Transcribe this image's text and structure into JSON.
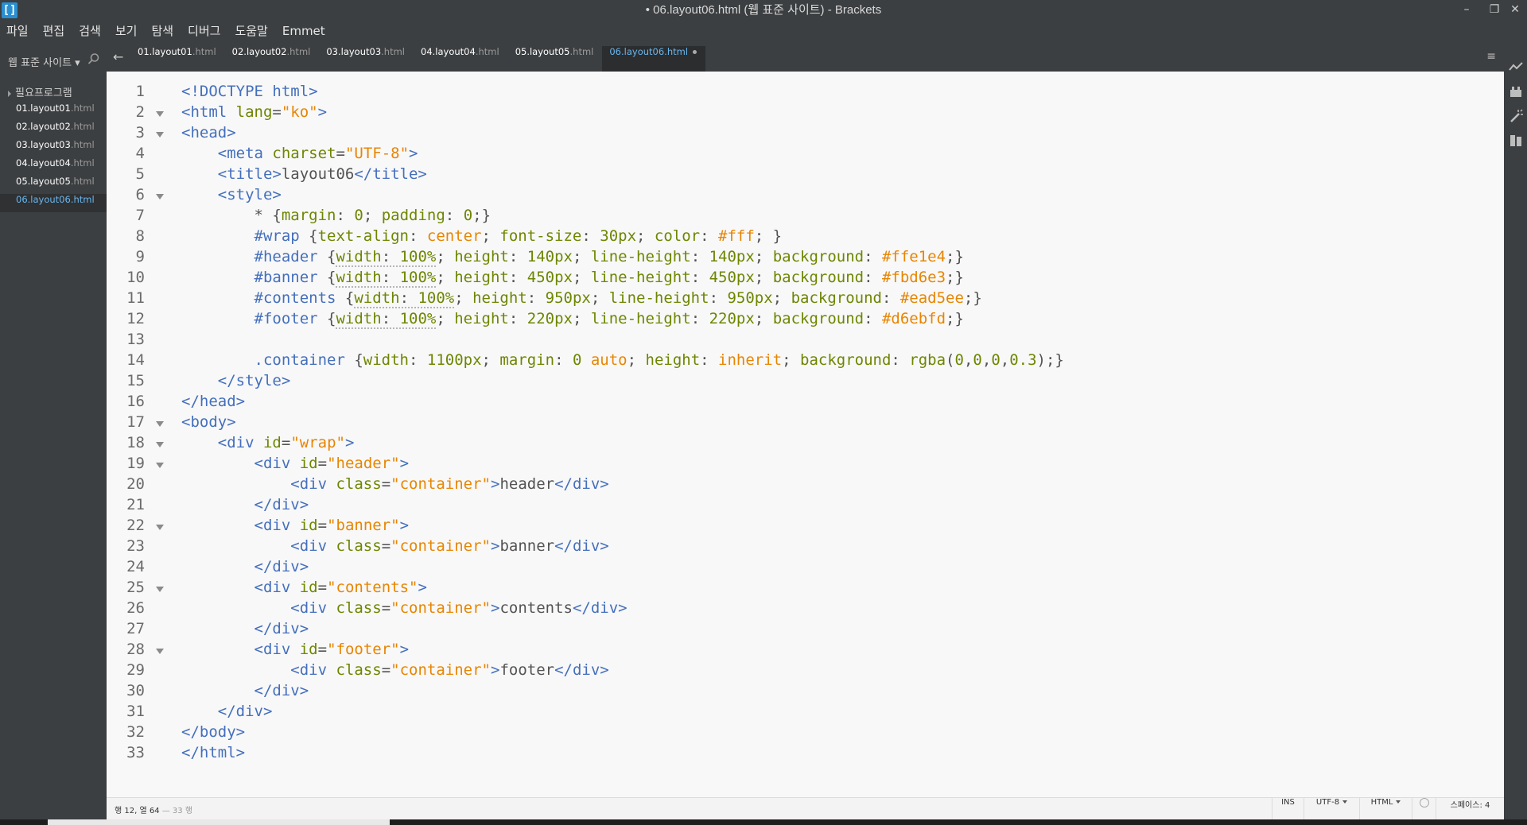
{
  "window": {
    "title": "• 06.layout06.html (웹 표준 사이트) - Brackets",
    "app_icon_glyph": "[]",
    "minimize": "–",
    "restore": "❐",
    "close": "✕"
  },
  "menu": [
    "파일",
    "편집",
    "검색",
    "보기",
    "탐색",
    "디버그",
    "도움말",
    "Emmet"
  ],
  "sidebar": {
    "project_name": "웹 표준 사이트 ▾",
    "folder": "필요프로그램",
    "files": [
      {
        "name": "01.layout01",
        "ext": ".html",
        "active": false
      },
      {
        "name": "02.layout02",
        "ext": ".html",
        "active": false
      },
      {
        "name": "03.layout03",
        "ext": ".html",
        "active": false
      },
      {
        "name": "04.layout04",
        "ext": ".html",
        "active": false
      },
      {
        "name": "05.layout05",
        "ext": ".html",
        "active": false
      },
      {
        "name": "06.layout06",
        "ext": ".html",
        "active": true
      }
    ]
  },
  "tabs": {
    "back_arrow": "←",
    "menu_glyph": "≡",
    "items": [
      {
        "name": "01.layout01",
        "ext": ".html",
        "active": false
      },
      {
        "name": "02.layout02",
        "ext": ".html",
        "active": false
      },
      {
        "name": "03.layout03",
        "ext": ".html",
        "active": false
      },
      {
        "name": "04.layout04",
        "ext": ".html",
        "active": false
      },
      {
        "name": "05.layout05",
        "ext": ".html",
        "active": false
      },
      {
        "name": "06.layout06",
        "ext": ".html",
        "active": true
      }
    ]
  },
  "editor": {
    "lines": [
      {
        "n": "1",
        "fold": false,
        "tokens": [
          [
            "tg",
            "<!DOCTYPE html>"
          ]
        ]
      },
      {
        "n": "2",
        "fold": true,
        "tokens": [
          [
            "tg",
            "<html "
          ],
          [
            "at",
            "lang"
          ],
          [
            "pn",
            "="
          ],
          [
            "av",
            "\"ko\""
          ],
          [
            "tg",
            ">"
          ]
        ]
      },
      {
        "n": "3",
        "fold": true,
        "tokens": [
          [
            "tg",
            "<head>"
          ]
        ]
      },
      {
        "n": "4",
        "fold": false,
        "tokens": [
          [
            "tx",
            "    "
          ],
          [
            "tg",
            "<meta "
          ],
          [
            "at",
            "charset"
          ],
          [
            "pn",
            "="
          ],
          [
            "av",
            "\"UTF-8\""
          ],
          [
            "tg",
            ">"
          ]
        ]
      },
      {
        "n": "5",
        "fold": false,
        "tokens": [
          [
            "tx",
            "    "
          ],
          [
            "tg",
            "<title>"
          ],
          [
            "tx",
            "layout06"
          ],
          [
            "tg",
            "</title>"
          ]
        ]
      },
      {
        "n": "6",
        "fold": true,
        "tokens": [
          [
            "tx",
            "    "
          ],
          [
            "tg",
            "<style>"
          ]
        ]
      },
      {
        "n": "7",
        "fold": false,
        "tokens": [
          [
            "tx",
            "        * {"
          ],
          [
            "pr",
            "margin"
          ],
          [
            "pn",
            ": "
          ],
          [
            "vn",
            "0"
          ],
          [
            "pn",
            "; "
          ],
          [
            "pr",
            "padding"
          ],
          [
            "pn",
            ": "
          ],
          [
            "vn",
            "0"
          ],
          [
            "pn",
            ";}"
          ]
        ]
      },
      {
        "n": "8",
        "fold": false,
        "tokens": [
          [
            "tx",
            "        "
          ],
          [
            "sel",
            "#wrap"
          ],
          [
            "pn",
            " {"
          ],
          [
            "pr",
            "text-align"
          ],
          [
            "pn",
            ": "
          ],
          [
            "vk",
            "center"
          ],
          [
            "pn",
            "; "
          ],
          [
            "pr",
            "font-size"
          ],
          [
            "pn",
            ": "
          ],
          [
            "vn",
            "30px"
          ],
          [
            "pn",
            "; "
          ],
          [
            "pr",
            "color"
          ],
          [
            "pn",
            ": "
          ],
          [
            "vk",
            "#fff"
          ],
          [
            "pn",
            "; }"
          ]
        ]
      },
      {
        "n": "9",
        "fold": false,
        "tokens": [
          [
            "tx",
            "        "
          ],
          [
            "sel",
            "#header"
          ],
          [
            "pn",
            " {"
          ],
          [
            "ul",
            "width: 100%"
          ],
          [
            "pn",
            "; "
          ],
          [
            "pr",
            "height"
          ],
          [
            "pn",
            ": "
          ],
          [
            "vn",
            "140px"
          ],
          [
            "pn",
            "; "
          ],
          [
            "pr",
            "line-height"
          ],
          [
            "pn",
            ": "
          ],
          [
            "vn",
            "140px"
          ],
          [
            "pn",
            "; "
          ],
          [
            "pr",
            "background"
          ],
          [
            "pn",
            ": "
          ],
          [
            "vk",
            "#ffe1e4"
          ],
          [
            "pn",
            ";}"
          ]
        ]
      },
      {
        "n": "10",
        "fold": false,
        "tokens": [
          [
            "tx",
            "        "
          ],
          [
            "sel",
            "#banner"
          ],
          [
            "pn",
            " {"
          ],
          [
            "ul",
            "width: 100%"
          ],
          [
            "pn",
            "; "
          ],
          [
            "pr",
            "height"
          ],
          [
            "pn",
            ": "
          ],
          [
            "vn",
            "450px"
          ],
          [
            "pn",
            "; "
          ],
          [
            "pr",
            "line-height"
          ],
          [
            "pn",
            ": "
          ],
          [
            "vn",
            "450px"
          ],
          [
            "pn",
            "; "
          ],
          [
            "pr",
            "background"
          ],
          [
            "pn",
            ": "
          ],
          [
            "vk",
            "#fbd6e3"
          ],
          [
            "pn",
            ";}"
          ]
        ]
      },
      {
        "n": "11",
        "fold": false,
        "tokens": [
          [
            "tx",
            "        "
          ],
          [
            "sel",
            "#contents"
          ],
          [
            "pn",
            " {"
          ],
          [
            "ul",
            "width: 100%"
          ],
          [
            "pn",
            "; "
          ],
          [
            "pr",
            "height"
          ],
          [
            "pn",
            ": "
          ],
          [
            "vn",
            "950px"
          ],
          [
            "pn",
            "; "
          ],
          [
            "pr",
            "line-height"
          ],
          [
            "pn",
            ": "
          ],
          [
            "vn",
            "950px"
          ],
          [
            "pn",
            "; "
          ],
          [
            "pr",
            "background"
          ],
          [
            "pn",
            ": "
          ],
          [
            "vk",
            "#ead5ee"
          ],
          [
            "pn",
            ";}"
          ]
        ]
      },
      {
        "n": "12",
        "fold": false,
        "tokens": [
          [
            "tx",
            "        "
          ],
          [
            "sel",
            "#footer"
          ],
          [
            "pn",
            " {"
          ],
          [
            "ul",
            "width: 100%"
          ],
          [
            "pn",
            "; "
          ],
          [
            "pr",
            "height"
          ],
          [
            "pn",
            ": "
          ],
          [
            "vn",
            "220px"
          ],
          [
            "pn",
            "; "
          ],
          [
            "pr",
            "line-height"
          ],
          [
            "pn",
            ": "
          ],
          [
            "vn",
            "220px"
          ],
          [
            "pn",
            "; "
          ],
          [
            "pr",
            "background"
          ],
          [
            "pn",
            ": "
          ],
          [
            "vk",
            "#d6ebfd"
          ],
          [
            "pn",
            ";}"
          ]
        ]
      },
      {
        "n": "13",
        "fold": false,
        "tokens": []
      },
      {
        "n": "14",
        "fold": false,
        "tokens": [
          [
            "tx",
            "        "
          ],
          [
            "sel",
            ".container"
          ],
          [
            "pn",
            " {"
          ],
          [
            "pr",
            "width"
          ],
          [
            "pn",
            ": "
          ],
          [
            "vn",
            "1100px"
          ],
          [
            "pn",
            "; "
          ],
          [
            "pr",
            "margin"
          ],
          [
            "pn",
            ": "
          ],
          [
            "vn",
            "0 "
          ],
          [
            "vk",
            "auto"
          ],
          [
            "pn",
            "; "
          ],
          [
            "pr",
            "height"
          ],
          [
            "pn",
            ": "
          ],
          [
            "vk",
            "inherit"
          ],
          [
            "pn",
            "; "
          ],
          [
            "pr",
            "background"
          ],
          [
            "pn",
            ": "
          ],
          [
            "vn",
            "rgba"
          ],
          [
            "pn",
            "("
          ],
          [
            "vn",
            "0"
          ],
          [
            "pn",
            ","
          ],
          [
            "vn",
            "0"
          ],
          [
            "pn",
            ","
          ],
          [
            "vn",
            "0"
          ],
          [
            "pn",
            ","
          ],
          [
            "vn",
            "0.3"
          ],
          [
            "pn",
            ");}"
          ]
        ]
      },
      {
        "n": "15",
        "fold": false,
        "tokens": [
          [
            "tx",
            "    "
          ],
          [
            "tg",
            "</style>"
          ]
        ]
      },
      {
        "n": "16",
        "fold": false,
        "tokens": [
          [
            "tg",
            "</head>"
          ]
        ]
      },
      {
        "n": "17",
        "fold": true,
        "tokens": [
          [
            "tg",
            "<body>"
          ]
        ]
      },
      {
        "n": "18",
        "fold": true,
        "tokens": [
          [
            "tx",
            "    "
          ],
          [
            "tg",
            "<div "
          ],
          [
            "at",
            "id"
          ],
          [
            "pn",
            "="
          ],
          [
            "av",
            "\"wrap\""
          ],
          [
            "tg",
            ">"
          ]
        ]
      },
      {
        "n": "19",
        "fold": true,
        "tokens": [
          [
            "tx",
            "        "
          ],
          [
            "tg",
            "<div "
          ],
          [
            "at",
            "id"
          ],
          [
            "pn",
            "="
          ],
          [
            "av",
            "\"header\""
          ],
          [
            "tg",
            ">"
          ]
        ]
      },
      {
        "n": "20",
        "fold": false,
        "tokens": [
          [
            "tx",
            "            "
          ],
          [
            "tg",
            "<div "
          ],
          [
            "at",
            "class"
          ],
          [
            "pn",
            "="
          ],
          [
            "av",
            "\"container\""
          ],
          [
            "tg",
            ">"
          ],
          [
            "tx",
            "header"
          ],
          [
            "tg",
            "</div>"
          ]
        ]
      },
      {
        "n": "21",
        "fold": false,
        "tokens": [
          [
            "tx",
            "        "
          ],
          [
            "tg",
            "</div>"
          ]
        ]
      },
      {
        "n": "22",
        "fold": true,
        "tokens": [
          [
            "tx",
            "        "
          ],
          [
            "tg",
            "<div "
          ],
          [
            "at",
            "id"
          ],
          [
            "pn",
            "="
          ],
          [
            "av",
            "\"banner\""
          ],
          [
            "tg",
            ">"
          ]
        ]
      },
      {
        "n": "23",
        "fold": false,
        "tokens": [
          [
            "tx",
            "            "
          ],
          [
            "tg",
            "<div "
          ],
          [
            "at",
            "class"
          ],
          [
            "pn",
            "="
          ],
          [
            "av",
            "\"container\""
          ],
          [
            "tg",
            ">"
          ],
          [
            "tx",
            "banner"
          ],
          [
            "tg",
            "</div>"
          ]
        ]
      },
      {
        "n": "24",
        "fold": false,
        "tokens": [
          [
            "tx",
            "        "
          ],
          [
            "tg",
            "</div>"
          ]
        ]
      },
      {
        "n": "25",
        "fold": true,
        "tokens": [
          [
            "tx",
            "        "
          ],
          [
            "tg",
            "<div "
          ],
          [
            "at",
            "id"
          ],
          [
            "pn",
            "="
          ],
          [
            "av",
            "\"contents\""
          ],
          [
            "tg",
            ">"
          ]
        ]
      },
      {
        "n": "26",
        "fold": false,
        "tokens": [
          [
            "tx",
            "            "
          ],
          [
            "tg",
            "<div "
          ],
          [
            "at",
            "class"
          ],
          [
            "pn",
            "="
          ],
          [
            "av",
            "\"container\""
          ],
          [
            "tg",
            ">"
          ],
          [
            "tx",
            "contents"
          ],
          [
            "tg",
            "</div>"
          ]
        ]
      },
      {
        "n": "27",
        "fold": false,
        "tokens": [
          [
            "tx",
            "        "
          ],
          [
            "tg",
            "</div>"
          ]
        ]
      },
      {
        "n": "28",
        "fold": true,
        "tokens": [
          [
            "tx",
            "        "
          ],
          [
            "tg",
            "<div "
          ],
          [
            "at",
            "id"
          ],
          [
            "pn",
            "="
          ],
          [
            "av",
            "\"footer\""
          ],
          [
            "tg",
            ">"
          ]
        ]
      },
      {
        "n": "29",
        "fold": false,
        "tokens": [
          [
            "tx",
            "            "
          ],
          [
            "tg",
            "<div "
          ],
          [
            "at",
            "class"
          ],
          [
            "pn",
            "="
          ],
          [
            "av",
            "\"container\""
          ],
          [
            "tg",
            ">"
          ],
          [
            "tx",
            "footer"
          ],
          [
            "tg",
            "</div>"
          ]
        ]
      },
      {
        "n": "30",
        "fold": false,
        "tokens": [
          [
            "tx",
            "        "
          ],
          [
            "tg",
            "</div>"
          ]
        ]
      },
      {
        "n": "31",
        "fold": false,
        "tokens": [
          [
            "tx",
            "    "
          ],
          [
            "tg",
            "</div>"
          ]
        ]
      },
      {
        "n": "32",
        "fold": false,
        "tokens": [
          [
            "tg",
            "</body>"
          ]
        ]
      },
      {
        "n": "33",
        "fold": false,
        "tokens": [
          [
            "tg",
            "</html>"
          ]
        ]
      }
    ]
  },
  "statusbar": {
    "cursor": "행 12, 열 64",
    "line_count": " — 33 행",
    "insert_mode": "INS",
    "encoding": "UTF-8",
    "language": "HTML",
    "indent": "스페이스: 4"
  },
  "colors": {
    "accent": "#6ab6ee",
    "tag": "#446fbd",
    "attribute": "#6d8600",
    "string": "#e88501",
    "editor_bg": "#f8f8f8",
    "chrome_bg": "#3c3f41"
  },
  "icons": {
    "project_search": "search-icon",
    "right_toolbar": [
      "live-preview-icon",
      "extension-manager-icon",
      "quick-edit-icon",
      "notes-icon"
    ]
  }
}
